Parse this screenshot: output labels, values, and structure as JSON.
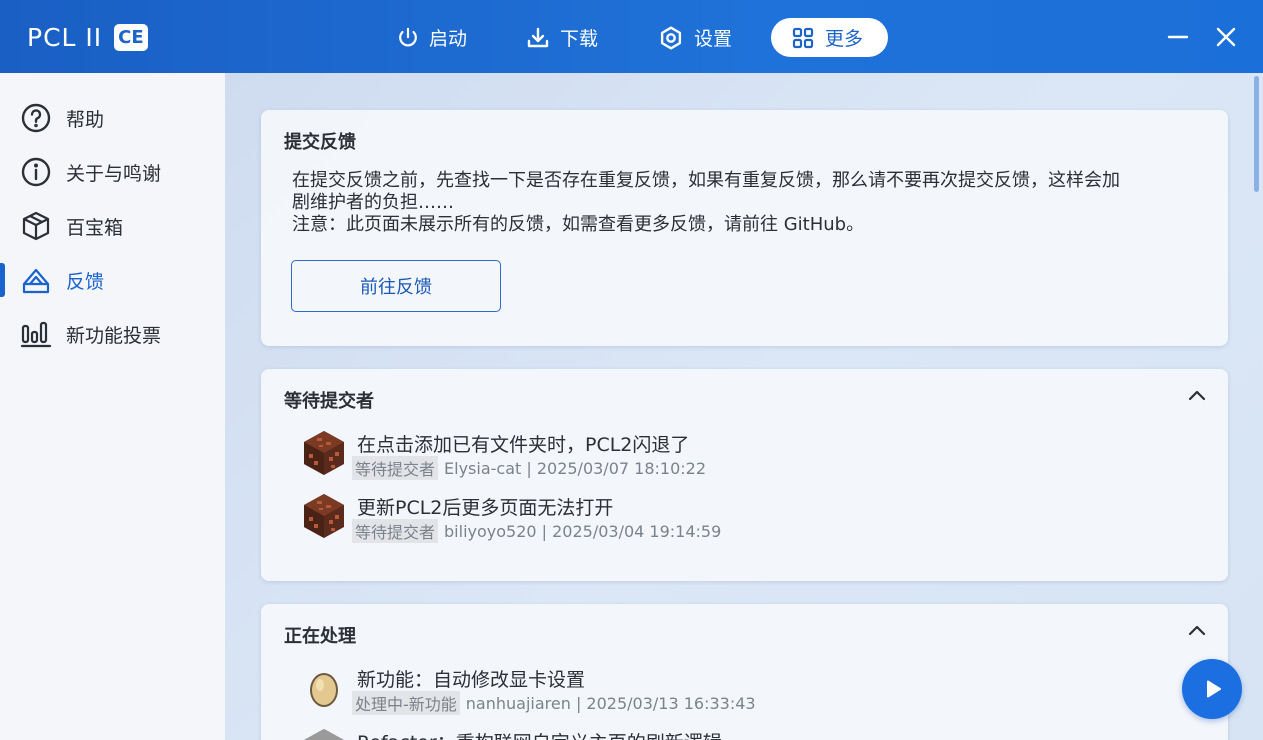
{
  "app": {
    "logo_text": "PCL II",
    "logo_badge": "CE"
  },
  "nav": {
    "items": [
      {
        "label": "启动",
        "icon": "power-icon"
      },
      {
        "label": "下载",
        "icon": "download-icon"
      },
      {
        "label": "设置",
        "icon": "settings-icon"
      },
      {
        "label": "更多",
        "icon": "grid-icon",
        "active": true
      }
    ]
  },
  "sidebar": {
    "items": [
      {
        "label": "帮助",
        "icon": "help-icon"
      },
      {
        "label": "关于与鸣谢",
        "icon": "info-icon"
      },
      {
        "label": "百宝箱",
        "icon": "box-icon"
      },
      {
        "label": "反馈",
        "icon": "feedback-icon",
        "active": true
      },
      {
        "label": "新功能投票",
        "icon": "vote-chart-icon"
      }
    ]
  },
  "feedback": {
    "title": "提交反馈",
    "text_line1": "在提交反馈之前，先查找一下是否存在重复反馈，如果有重复反馈，那么请不要再次提交反馈，这样会加",
    "text_line2": "剧维护者的负担……",
    "text_line3": "注意：此页面未展示所有的反馈，如需查看更多反馈，请前往 GitHub。",
    "button": "前往反馈"
  },
  "waiting": {
    "title": "等待提交者",
    "issues": [
      {
        "title": "在点击添加已有文件夹时，PCL2闪退了",
        "tag": "等待提交者",
        "meta": "Elysia-cat | 2025/03/07 18:10:22"
      },
      {
        "title": "更新PCL2后更多页面无法打开",
        "tag": "等待提交者",
        "meta": "biliyoyo520 | 2025/03/04 19:14:59"
      }
    ]
  },
  "processing": {
    "title": "正在处理",
    "issues": [
      {
        "title": "新功能：自动修改显卡设置",
        "tag": "处理中-新功能",
        "meta": "nanhuajiaren | 2025/03/13 16:33:43"
      },
      {
        "title": "Refactor：重构联网自定义主页的刷新逻辑"
      }
    ]
  },
  "colors": {
    "accent": "#1a63cf",
    "titlebar": "#1f72d9"
  }
}
